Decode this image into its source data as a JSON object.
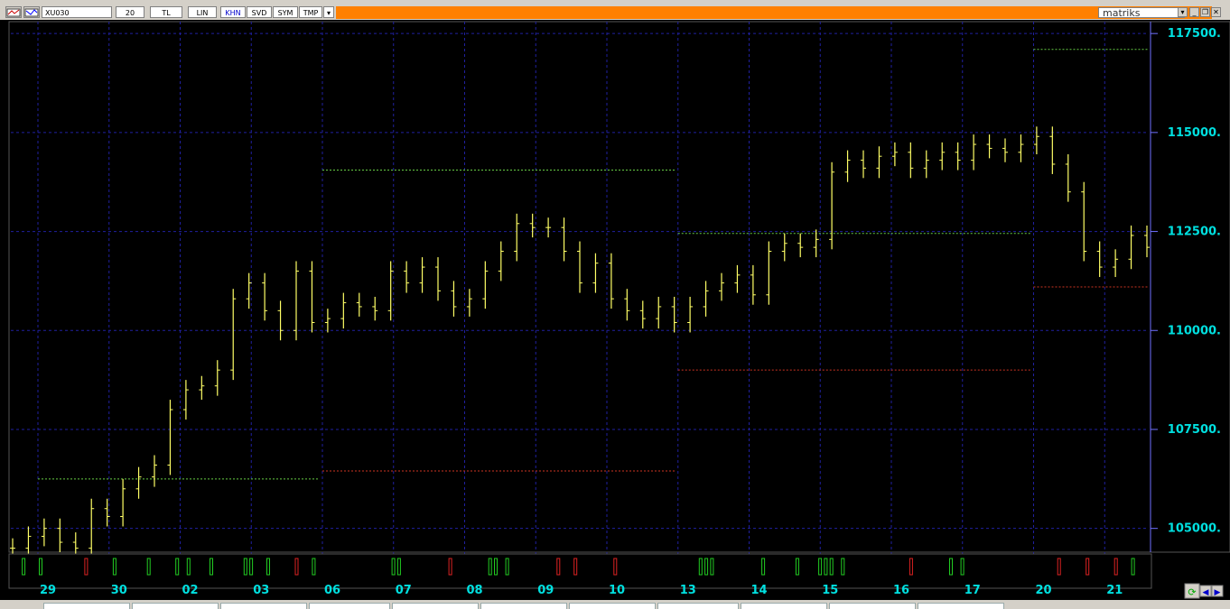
{
  "toolbar": {
    "symbol": "XU030",
    "period": "20",
    "currency": "TL",
    "scale": "LIN",
    "buttons": [
      "KHN",
      "SVD",
      "SYM",
      "TMP"
    ],
    "brand": "matriks",
    "dropdown_icon": "chevron-down-icon",
    "window_icons": [
      "minimize-icon",
      "restore-icon",
      "close-icon"
    ]
  },
  "colors": {
    "background": "#000000",
    "bars": "#ffff66",
    "grid": "#2020a0",
    "axis_labels": "#00e0e0",
    "pivot_green": "#66cc44",
    "pivot_red": "#cc3322",
    "signal_buy": "#22cc22",
    "signal_sell": "#dd2222",
    "accent_toolbar": "#ff8000"
  },
  "chart_data": {
    "type": "ohlc",
    "y_axis": {
      "ticks": [
        "117500.",
        "115000.",
        "112500.",
        "110000.",
        "107500.",
        "105000."
      ],
      "tick_values": [
        117500,
        115000,
        112500,
        110000,
        107500,
        105000
      ],
      "ylim": [
        104400,
        117800
      ],
      "position": "right",
      "grid": true
    },
    "x_axis": {
      "labels": [
        "29",
        "30",
        "02",
        "03",
        "06",
        "07",
        "08",
        "09",
        "10",
        "13",
        "14",
        "15",
        "16",
        "17",
        "20",
        "21"
      ],
      "grid": true
    },
    "series": [
      {
        "values": [
          104500,
          104800,
          105000,
          104650,
          104500,
          105500,
          105300,
          106000,
          106300,
          106600,
          108000,
          108500,
          108600,
          109000,
          110800,
          111200,
          110500,
          110000,
          111500,
          110200,
          110300,
          110700,
          110600,
          110500,
          111500,
          111200,
          111600,
          111000,
          110600,
          110800,
          111500,
          112000,
          112700,
          112600,
          112600,
          112000,
          111200,
          111700,
          110800,
          110500,
          110300,
          110600,
          110200,
          110600,
          111000,
          111200,
          111400,
          110900,
          112000,
          112200,
          112100,
          112300,
          114000,
          114300,
          114100,
          114400,
          114500,
          114100,
          114300,
          114500,
          114300,
          114700,
          114600,
          114500,
          114700,
          114900,
          114200,
          113500,
          112000,
          111600,
          111800,
          112400,
          112100
        ]
      }
    ],
    "pivot_levels": [
      {
        "from_label": "29",
        "to_label": "03",
        "value": 106250,
        "color": "green"
      },
      {
        "from_label": "06",
        "to_label": "10",
        "value": 114050,
        "color": "green"
      },
      {
        "from_label": "06",
        "to_label": "10",
        "value": 106450,
        "color": "red"
      },
      {
        "from_label": "13",
        "to_label": "17",
        "value": 112450,
        "color": "green"
      },
      {
        "from_label": "13",
        "to_label": "17",
        "value": 109000,
        "color": "red"
      },
      {
        "from_label": "20",
        "to_label": "21",
        "value": 117100,
        "color": "green"
      },
      {
        "from_label": "20",
        "to_label": "21",
        "value": 111100,
        "color": "red"
      }
    ],
    "signals": [
      {
        "at": 0.01,
        "type": "buy"
      },
      {
        "at": 0.025,
        "type": "buy"
      },
      {
        "at": 0.065,
        "type": "sell"
      },
      {
        "at": 0.09,
        "type": "buy"
      },
      {
        "at": 0.12,
        "type": "buy"
      },
      {
        "at": 0.145,
        "type": "buy"
      },
      {
        "at": 0.155,
        "type": "buy"
      },
      {
        "at": 0.175,
        "type": "buy"
      },
      {
        "at": 0.205,
        "type": "buy"
      },
      {
        "at": 0.21,
        "type": "buy"
      },
      {
        "at": 0.225,
        "type": "buy"
      },
      {
        "at": 0.25,
        "type": "sell"
      },
      {
        "at": 0.265,
        "type": "buy"
      },
      {
        "at": 0.335,
        "type": "buy"
      },
      {
        "at": 0.34,
        "type": "buy"
      },
      {
        "at": 0.385,
        "type": "sell"
      },
      {
        "at": 0.42,
        "type": "buy"
      },
      {
        "at": 0.425,
        "type": "buy"
      },
      {
        "at": 0.435,
        "type": "buy"
      },
      {
        "at": 0.48,
        "type": "sell"
      },
      {
        "at": 0.495,
        "type": "sell"
      },
      {
        "at": 0.53,
        "type": "sell"
      },
      {
        "at": 0.605,
        "type": "buy"
      },
      {
        "at": 0.61,
        "type": "buy"
      },
      {
        "at": 0.615,
        "type": "buy"
      },
      {
        "at": 0.66,
        "type": "buy"
      },
      {
        "at": 0.69,
        "type": "buy"
      },
      {
        "at": 0.71,
        "type": "buy"
      },
      {
        "at": 0.715,
        "type": "buy"
      },
      {
        "at": 0.72,
        "type": "buy"
      },
      {
        "at": 0.73,
        "type": "buy"
      },
      {
        "at": 0.79,
        "type": "sell"
      },
      {
        "at": 0.825,
        "type": "buy"
      },
      {
        "at": 0.835,
        "type": "buy"
      },
      {
        "at": 0.92,
        "type": "sell"
      },
      {
        "at": 0.945,
        "type": "sell"
      },
      {
        "at": 0.97,
        "type": "sell"
      },
      {
        "at": 0.985,
        "type": "buy"
      }
    ]
  }
}
